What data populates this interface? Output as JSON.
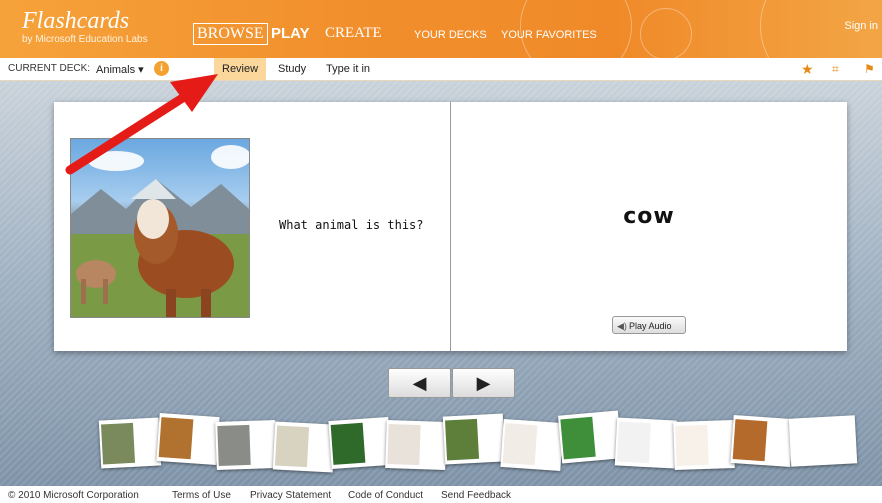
{
  "brand": {
    "title": "Flashcards",
    "subtitle": "by Microsoft Education Labs"
  },
  "nav": {
    "browse": "BROWSE",
    "play": "PLAY",
    "create": "CREATE",
    "your_decks": "YOUR DECKS",
    "your_favorites": "YOUR FAVORITES",
    "sign_in": "Sign in"
  },
  "toolbar": {
    "current_deck_label": "CURRENT DECK:",
    "deck_name": "Animals ▾",
    "info_icon": "info-icon",
    "tabs": [
      "Review",
      "Study",
      "Type it in"
    ],
    "active_tab": "Review",
    "icons": [
      "star-icon",
      "fullscreen-icon",
      "flag-icon"
    ]
  },
  "card": {
    "question": "What animal is this?",
    "answer": "cow",
    "play_audio": "Play Audio",
    "image": "cow-photo"
  },
  "controls": {
    "prev_icon": "◀",
    "next_icon": "▶"
  },
  "thumbnails": [
    {
      "icon": "deer"
    },
    {
      "icon": "dog"
    },
    {
      "icon": "elephant"
    },
    {
      "icon": "frog"
    },
    {
      "icon": "fish"
    },
    {
      "icon": "hamster"
    },
    {
      "icon": "bird"
    },
    {
      "icon": "chicken"
    },
    {
      "icon": "lizard"
    },
    {
      "icon": "spider"
    },
    {
      "icon": "starfish"
    },
    {
      "icon": "tiger"
    },
    {
      "icon": "blank"
    }
  ],
  "footer": {
    "copyright": "© 2010 Microsoft Corporation",
    "terms": "Terms of Use",
    "privacy": "Privacy Statement",
    "conduct": "Code of Conduct",
    "feedback": "Send Feedback"
  },
  "colors": {
    "brand_orange": "#f18f2c",
    "active_tab": "#fbd79c",
    "annotation_arrow": "#e41b17"
  }
}
